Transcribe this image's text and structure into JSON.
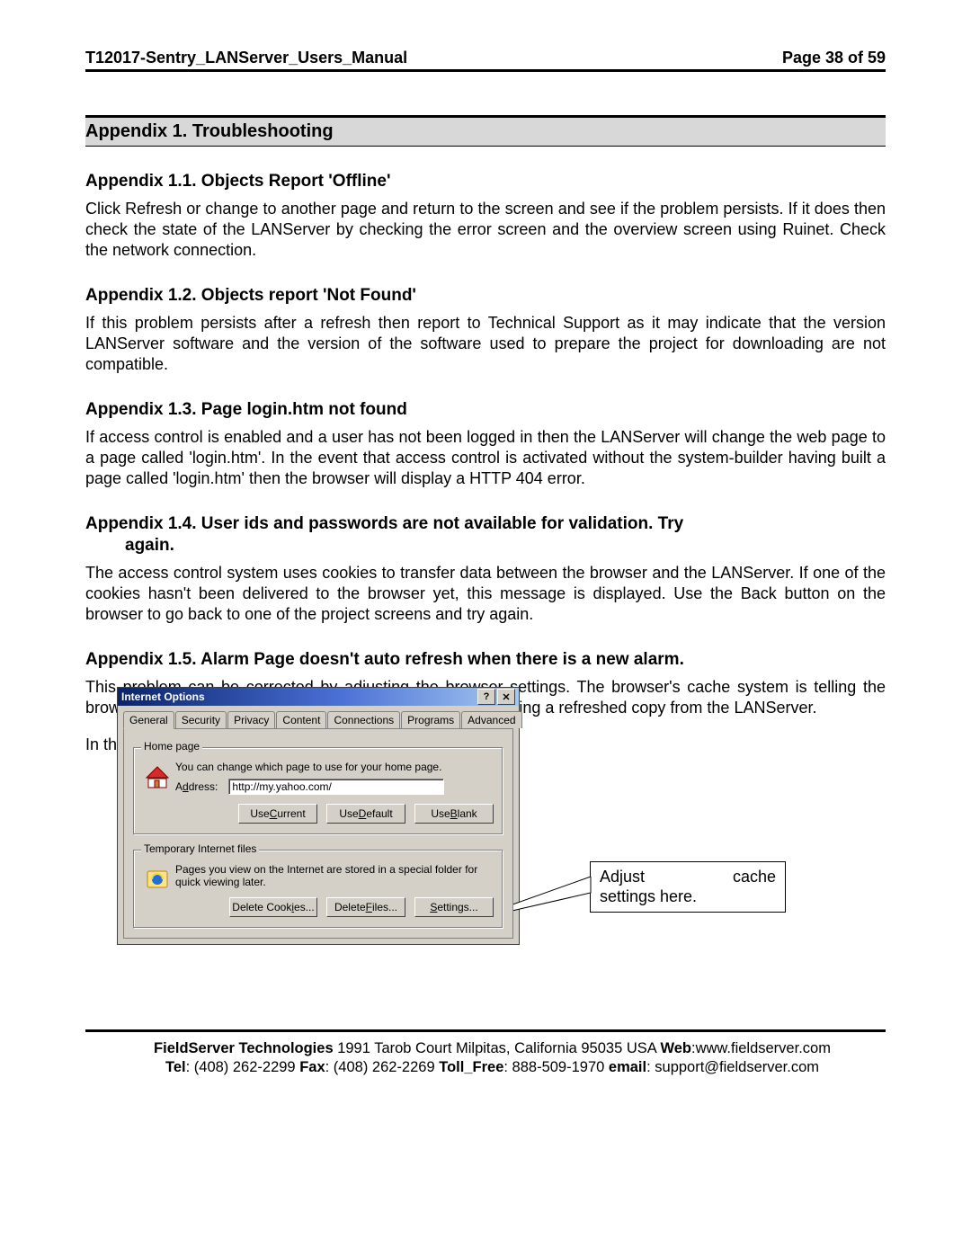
{
  "header": {
    "doc_title": "T12017-Sentry_LANServer_Users_Manual",
    "page_label": "Page 38 of 59"
  },
  "appendix_title": "Appendix 1. Troubleshooting",
  "sections": {
    "s11_head": "Appendix 1.1.   Objects Report 'Offline'",
    "s11_body": "Click Refresh or change to another page and return to the screen and see if the problem persists.  If it does then check the state of the LANServer by checking the error screen and the overview screen using Ruinet.  Check the network connection.",
    "s12_head": "Appendix 1.2.   Objects report 'Not Found'",
    "s12_body": "If this problem persists after a refresh then report to Technical Support as it may indicate that the version LANServer software and the version of the software used to prepare the project for downloading are not compatible.",
    "s13_head": "Appendix 1.3.   Page login.htm not found",
    "s13_body": "If access control is enabled and a user has not been logged in then the LANServer will change the web page to a page called 'login.htm'.  In the event that access control is activated without the system-builder having built a page called 'login.htm' then the browser will display a HTTP 404 error.",
    "s14_head_l1": "Appendix 1.4.   User ids and passwords are not available for validation. Try",
    "s14_head_l2": "again.",
    "s14_body": "The access control system uses cookies to transfer data between the browser and the LANServer. If one of the cookies hasn't been delivered to the browser yet, this message is displayed.  Use the Back button on the browser to go back to one of the project screens and try again.",
    "s15_head": "Appendix 1.5.   Alarm Page doesn't auto refresh when there is a new alarm.",
    "s15_body": "This problem can be corrected by adjusting the browser settings. The browser's cache system is telling the browser used use the cached copy of a page instead of reading a refreshed copy from the LANServer.",
    "s15_body2": "In the browser 'Tools' menu, select the 'Internet Options'"
  },
  "dialog": {
    "title": "Internet Options",
    "tabs": [
      "General",
      "Security",
      "Privacy",
      "Content",
      "Connections",
      "Programs",
      "Advanced"
    ],
    "homepage_label": "Home page",
    "homepage_hint": "You can change which page to use for your home page.",
    "address_label_pre": "A",
    "address_label_u": "d",
    "address_label_post": "dress:",
    "address_value": "http://my.yahoo.com/",
    "use_current_pre": "Use ",
    "use_current_u": "C",
    "use_current_post": "urrent",
    "use_default_pre": "Use ",
    "use_default_u": "D",
    "use_default_post": "efault",
    "use_blank_pre": "Use ",
    "use_blank_u": "B",
    "use_blank_post": "lank",
    "tempfiles_label": "Temporary Internet files",
    "tempfiles_hint": "Pages you view on the Internet are stored in a special folder for quick viewing later.",
    "delete_cookies_pre": "Delete Cook",
    "delete_cookies_u": "i",
    "delete_cookies_post": "es...",
    "delete_files_pre": "Delete ",
    "delete_files_u": "F",
    "delete_files_post": "iles...",
    "settings_u": "S",
    "settings_post": "ettings..."
  },
  "callout": {
    "l1a": "Adjust",
    "l1b": "cache",
    "l2": "settings here."
  },
  "footer": {
    "company": "FieldServer Technologies",
    "addr": " 1991 Tarob Court Milpitas, California 95035 USA  ",
    "web_lbl": "Web",
    "web_val": ":www.fieldserver.com",
    "tel_lbl": "Tel",
    "tel_val": ": (408) 262-2299  ",
    "fax_lbl": "Fax",
    "fax_val": ": (408) 262-2269  ",
    "toll_lbl": "Toll_Free",
    "toll_val": ": 888-509-1970   ",
    "email_lbl": "email",
    "email_val": ": support@fieldserver.com"
  }
}
